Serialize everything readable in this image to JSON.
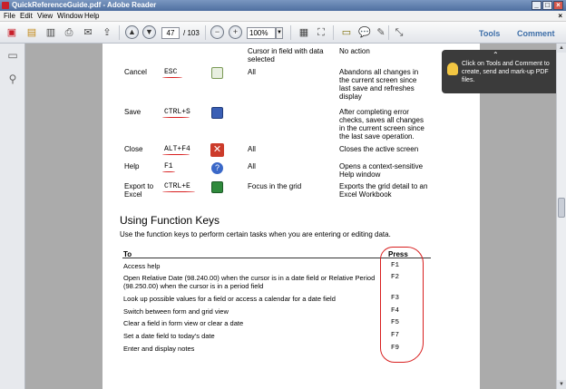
{
  "window": {
    "title": "QuickReferenceGuide.pdf - Adobe Reader",
    "controls": [
      "_",
      "□",
      "×"
    ]
  },
  "menubar": {
    "items": [
      "File",
      "Edit",
      "View",
      "Window",
      "Help"
    ],
    "close": "×"
  },
  "toolbar": {
    "current_page": "47",
    "total_pages": "/ 103",
    "zoom": "100%",
    "tools_label": "Tools",
    "comment_label": "Comment"
  },
  "tooltip": {
    "text": "Click on Tools and Comment to create, send and mark-up PDF files."
  },
  "shortcuts": {
    "top_row": {
      "target": "Cursor in field with data selected",
      "result": "No action"
    },
    "rows": [
      {
        "command": "Cancel",
        "keys": "ESC",
        "icon": "cancel-doc-icon",
        "target": "All",
        "result": "Abandons all changes in the current screen since last save and refreshes display"
      },
      {
        "command": "Save",
        "keys": "CTRL+S",
        "icon": "save-disk-icon",
        "target": "After completing error checks, saves all changes in the current screen since the last save operation.",
        "result": ""
      },
      {
        "command": "Close",
        "keys": "ALT+F4",
        "icon": "close-x-icon",
        "target": "All",
        "result": "Closes the active screen"
      },
      {
        "command": "Help",
        "keys": "F1",
        "icon": "help-question-icon",
        "target": "All",
        "result": "Opens a context-sensitive Help window"
      },
      {
        "command": "Export to Excel",
        "keys": "CTRL+E",
        "icon": "excel-icon",
        "target": "Focus in the grid",
        "result": "Exports the grid detail to an Excel Workbook"
      }
    ]
  },
  "function_keys": {
    "title": "Using Function Keys",
    "description": "Use the function keys to perform certain tasks when you are entering or editing data.",
    "header_to": "To",
    "header_press": "Press",
    "rows": [
      {
        "to": "Access help",
        "press": "F1"
      },
      {
        "to": "Open Relative Date (98.240.00) when the cursor is in a date field or Relative Period (98.250.00) when the cursor is in a period field",
        "press": "F2"
      },
      {
        "to": "Look up possible values for a field or access a calendar for a date field",
        "press": "F3"
      },
      {
        "to": "Switch between form and grid view",
        "press": "F4"
      },
      {
        "to": "Clear a field in form view or clear a date",
        "press": "F5"
      },
      {
        "to": "Set a date field to today's date",
        "press": "F7"
      },
      {
        "to": "Enter and display notes",
        "press": "F9"
      }
    ]
  },
  "colors": {
    "annotation_red": "#d81e1e",
    "tools_blue": "#3d6ea8",
    "tooltip_bg": "#3b3b3b"
  }
}
